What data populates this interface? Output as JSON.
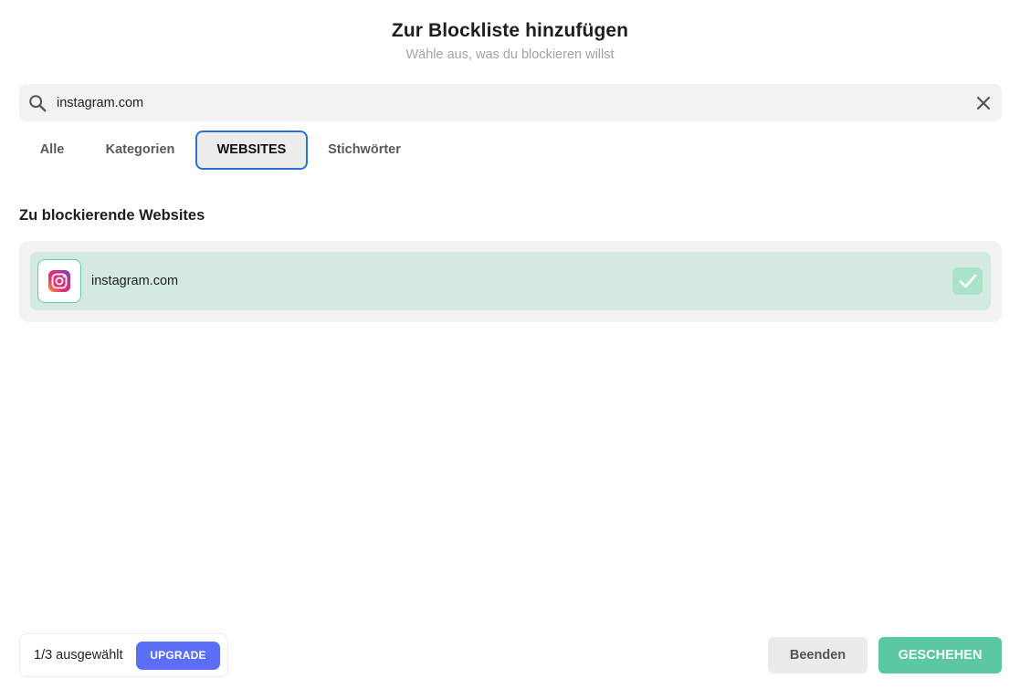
{
  "dialog": {
    "title": "Zur Blockliste hinzufügen",
    "subtitle": "Wähle aus, was du blockieren willst"
  },
  "search": {
    "value": "instagram.com",
    "icon": "search-icon",
    "clear_icon": "close-icon"
  },
  "tabs": [
    {
      "label": "Alle"
    },
    {
      "label": "Kategorien"
    },
    {
      "label": "WEBSITES"
    },
    {
      "label": "Stichwörter"
    }
  ],
  "tabs_active": "WEBSITES",
  "section": {
    "title": "Zu blockierende Websites"
  },
  "websites": [
    {
      "label": "instagram.com",
      "icon": "instagram-icon",
      "checked": true
    }
  ],
  "footer": {
    "count_text": "1/3 ausgewählt",
    "upgrade_label": "UPGRADE",
    "quit_label": "Beenden",
    "done_label": "GESCHEHEN"
  },
  "colors": {
    "accent_blue": "#5b6ef5",
    "active_tab_border": "#2a6fd6",
    "success_green": "#5cc7a3",
    "selected_row": "#d3e9e1"
  }
}
